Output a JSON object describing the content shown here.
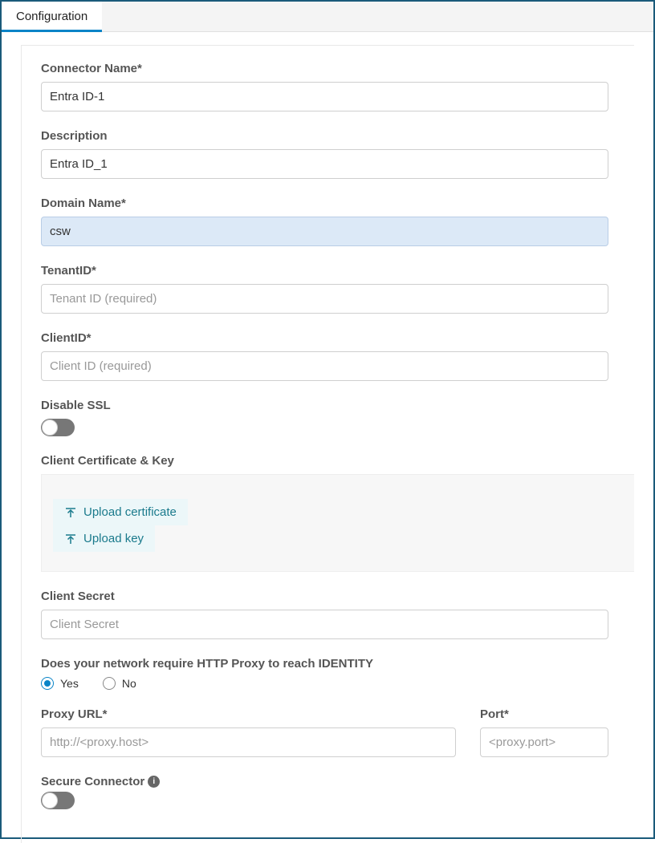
{
  "tabs": {
    "configuration": "Configuration"
  },
  "form": {
    "connector_name": {
      "label": "Connector Name*",
      "value": "Entra ID-1"
    },
    "description": {
      "label": "Description",
      "value": "Entra ID_1"
    },
    "domain_name": {
      "label": "Domain Name*",
      "value": "csw"
    },
    "tenant_id": {
      "label": "TenantID*",
      "placeholder": "Tenant ID (required)",
      "value": ""
    },
    "client_id": {
      "label": "ClientID*",
      "placeholder": "Client ID (required)",
      "value": ""
    },
    "disable_ssl": {
      "label": "Disable SSL",
      "on": false
    },
    "cert_key": {
      "label": "Client Certificate & Key",
      "upload_cert": "Upload certificate",
      "upload_key": "Upload key"
    },
    "client_secret": {
      "label": "Client Secret",
      "placeholder": "Client Secret",
      "value": ""
    },
    "proxy_question": {
      "label": "Does your network require HTTP Proxy to reach IDENTITY",
      "yes": "Yes",
      "no": "No",
      "selected": "yes"
    },
    "proxy_url": {
      "label": "Proxy URL*",
      "placeholder": "http://<proxy.host>",
      "value": ""
    },
    "port": {
      "label": "Port*",
      "placeholder": "<proxy.port>",
      "value": ""
    },
    "secure_connector": {
      "label": "Secure Connector",
      "on": false
    }
  }
}
